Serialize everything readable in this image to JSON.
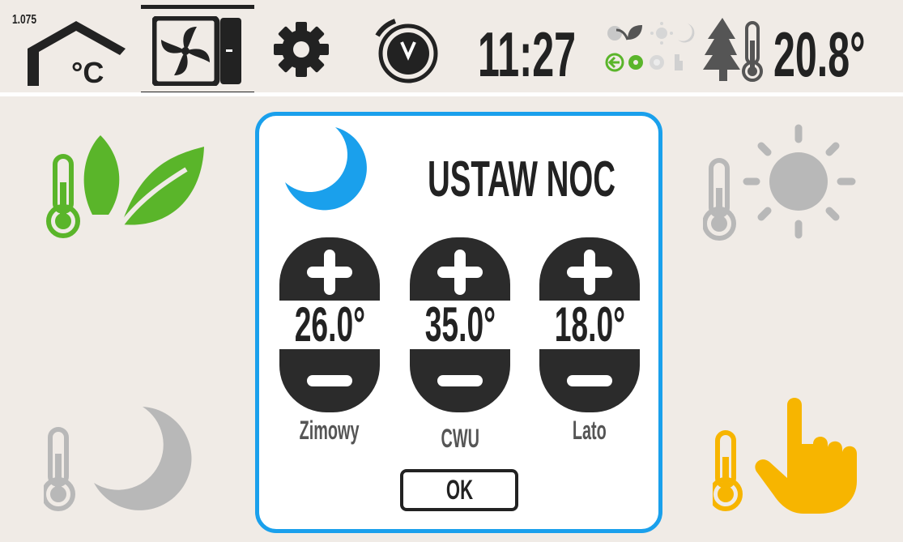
{
  "header": {
    "version": "1.075",
    "time": "11:27",
    "outside_temperature": "20.8°",
    "tabs": [
      {
        "name": "heating-temperature",
        "icon": "house-celsius-icon",
        "active": false
      },
      {
        "name": "ventilation",
        "icon": "fan-unit-icon",
        "active": true
      },
      {
        "name": "settings",
        "icon": "gear-icon",
        "active": false
      },
      {
        "name": "timer",
        "icon": "stopwatch-icon",
        "active": false
      }
    ],
    "mode_status_icons": [
      "frost-icon",
      "eco-leaf-icon",
      "sun-icon",
      "moon-icon",
      "heat-recovery-icon",
      "gear-green-icon",
      "disc-icon",
      "hand-icon"
    ]
  },
  "modes": {
    "eco": {
      "icon": "thermometer-leaf-icon",
      "color": "#5ab52a"
    },
    "day": {
      "icon": "thermometer-sun-icon",
      "color": "#b8b8b8"
    },
    "night": {
      "icon": "thermometer-moon-icon",
      "color": "#b8b8b8"
    },
    "manual": {
      "icon": "thermometer-hand-icon",
      "color": "#f7b500"
    }
  },
  "dialog": {
    "title": "USTAW NOC",
    "icon": "moon-icon",
    "accent_color": "#1aa0ec",
    "ok_label": "OK",
    "setpoints": [
      {
        "label": "Zimowy",
        "value": "26.0°"
      },
      {
        "label": "CWU",
        "value": "35.0°"
      },
      {
        "label": "Lato",
        "value": "18.0°"
      }
    ]
  }
}
